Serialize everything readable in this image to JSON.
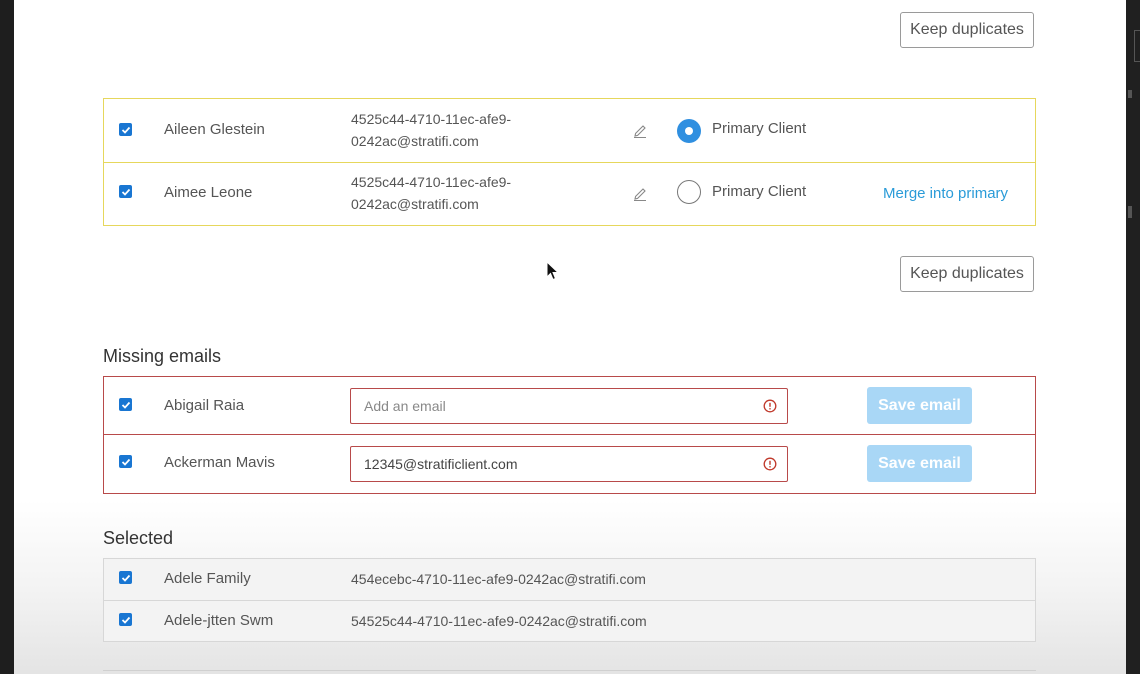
{
  "keep_duplicates_label": "Keep duplicates",
  "duplicates": [
    {
      "name": "Aileen Glestein",
      "email_line1": "4525c44-4710-11ec-afe9-",
      "email_line2": "0242ac@stratifi.com",
      "primary_label": "Primary Client",
      "is_primary": true,
      "checked": true
    },
    {
      "name": "Aimee Leone",
      "email_line1": "4525c44-4710-11ec-afe9-",
      "email_line2": "0242ac@stratifi.com",
      "primary_label": "Primary Client",
      "is_primary": false,
      "merge_label": "Merge into primary",
      "checked": true
    }
  ],
  "missing_emails": {
    "title": "Missing emails",
    "save_label": "Save email",
    "rows": [
      {
        "name": "Abigail Raia",
        "value": "",
        "placeholder": "Add an email",
        "checked": true
      },
      {
        "name": "Ackerman Mavis",
        "value": "12345@stratificlient.com",
        "placeholder": "Add an email",
        "checked": true
      }
    ]
  },
  "selected": {
    "title": "Selected",
    "rows": [
      {
        "name": "Adele Family",
        "email": "454ecebc-4710-11ec-afe9-0242ac@stratifi.com",
        "checked": true
      },
      {
        "name": "Adele-jtten Swm",
        "email": "54525c44-4710-11ec-afe9-0242ac@stratifi.com",
        "checked": true
      }
    ]
  },
  "colors": {
    "accent": "#1976d2",
    "link": "#2a9bd8",
    "warning": "#b84a4a",
    "duplicate_border": "#e6d75c",
    "save_disabled": "#a9d7f6"
  },
  "icons": {
    "checkbox": "checkbox-checked-icon",
    "edit": "pencil-icon",
    "warning": "alert-circle-icon",
    "cursor": "mouse-pointer-icon"
  }
}
